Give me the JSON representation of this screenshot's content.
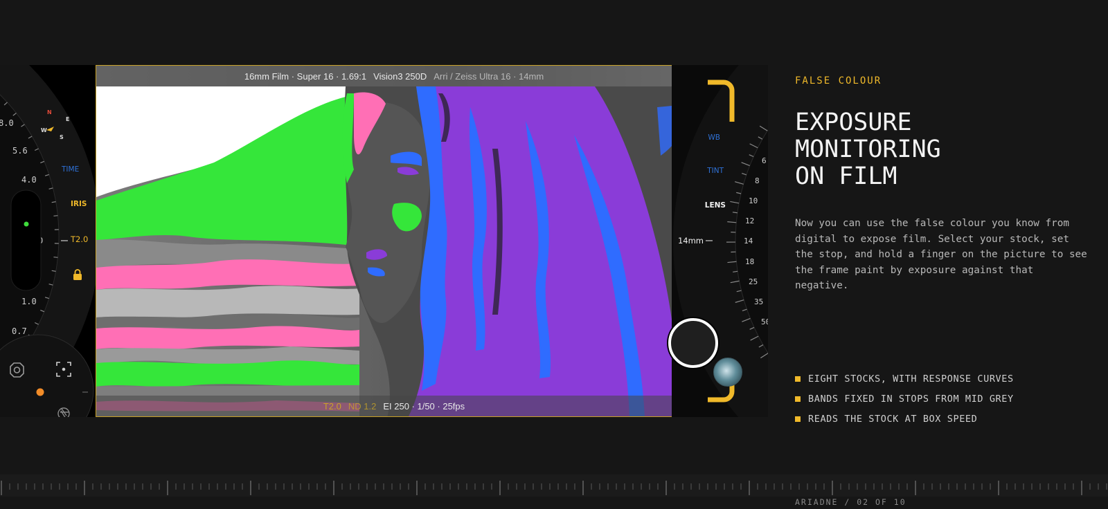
{
  "viewfinder": {
    "top_main": "16mm Film · Super 16 · 1.69:1",
    "top_stock": "Vision3 250D",
    "top_lens": "Arri / Zeiss Ultra 16 · 14mm",
    "bottom_stop": "T2.0",
    "bottom_nd": "ND 1.2",
    "bottom_main": "EI 250 · 1/50 · 25fps"
  },
  "left_dial": {
    "ticks": [
      "8.0",
      "5.6",
      "4.0",
      "1.0",
      "0.7"
    ],
    "compass": {
      "n": "N",
      "e": "E",
      "w": "W",
      "s": "S"
    },
    "modes": {
      "time": "TIME",
      "iris": "IRIS"
    },
    "current_value": "T2.0",
    "marker_value": "0"
  },
  "right_dial": {
    "modes": {
      "wb": "WB",
      "tint": "TINT",
      "lens": "LENS"
    },
    "current_value": "14mm",
    "ticks": [
      "6",
      "8",
      "10",
      "12",
      "14",
      "18",
      "25",
      "35",
      "50"
    ]
  },
  "panel": {
    "eyebrow": "FALSE COLOUR",
    "headline": [
      "EXPOSURE",
      "MONITORING",
      "ON FILM"
    ],
    "body": "Now you can use the false colour you know from digital to expose film. Select your stock, set the stop, and hold a finger on the picture to see the frame paint by exposure against that negative.",
    "features": [
      "EIGHT STOCKS, WITH RESPONSE CURVES",
      "BANDS FIXED IN STOPS FROM MID GREY",
      "READS THE STOCK AT BOX SPEED"
    ]
  },
  "footer": {
    "label": "ARIADNE / 02 OF 10"
  },
  "colors": {
    "accent": "#f0b92a",
    "false_pink": "#ff6fb5",
    "false_green": "#35e63a",
    "false_blue": "#2f6cff",
    "false_purple": "#8a3cd8"
  },
  "icons": {
    "lock": "lock-icon",
    "settings": "camera-settings-icon",
    "focus": "focus-frame-icon",
    "aperture": "aperture-icon",
    "shutter": "shutter-button",
    "gallery": "gallery-thumbnail"
  }
}
